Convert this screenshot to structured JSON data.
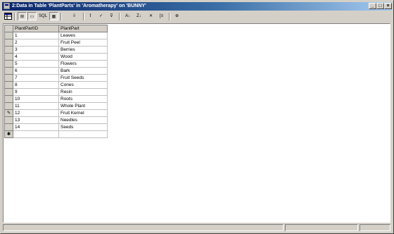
{
  "window": {
    "title": "2:Data in Table 'PlantParts' in 'Aromatherapy' on 'BUNNY'",
    "caption_buttons": [
      "_",
      "□",
      "×"
    ]
  },
  "toolbar": {
    "buttons": [
      {
        "name": "grid-results-icon"
      },
      {
        "name": "show-diagram-icon",
        "label": "⊞"
      },
      {
        "name": "show-grid-icon",
        "label": "▭"
      },
      {
        "name": "show-sql-icon",
        "label": "SQL"
      },
      {
        "name": "show-results-icon",
        "label": "▦"
      },
      {
        "name": "change-type-icon",
        "label": "⇩"
      },
      {
        "name": "run-icon",
        "label": "!"
      },
      {
        "name": "verify-sql-icon",
        "label": "✓"
      },
      {
        "name": "remove-filter-icon",
        "label": "⊽"
      },
      {
        "name": "sort-ascending-icon",
        "label": "A↓"
      },
      {
        "name": "sort-descending-icon",
        "label": "Z↓"
      },
      {
        "name": "remove-filter-x-icon",
        "label": "✕"
      },
      {
        "name": "group-by-icon",
        "label": "[≡"
      },
      {
        "name": "add-table-icon",
        "label": "⊕"
      }
    ]
  },
  "grid": {
    "columns": [
      "PlantPartID",
      "PlantPart"
    ],
    "rows": [
      [
        "1",
        "Leaves"
      ],
      [
        "2",
        "Fruit Peel"
      ],
      [
        "3",
        "Berries"
      ],
      [
        "4",
        "Wood"
      ],
      [
        "5",
        "Flowers"
      ],
      [
        "6",
        "Bark"
      ],
      [
        "7",
        "Fruit Seeds"
      ],
      [
        "8",
        "Cones"
      ],
      [
        "9",
        "Resin"
      ],
      [
        "10",
        "Roots"
      ],
      [
        "11",
        "Whole Plant"
      ],
      [
        "12",
        "Fruit Kernel"
      ],
      [
        "13",
        "Needles"
      ],
      [
        "14",
        "Seeds"
      ]
    ],
    "editing_marker": "✎",
    "new_row_marker": "✱"
  }
}
